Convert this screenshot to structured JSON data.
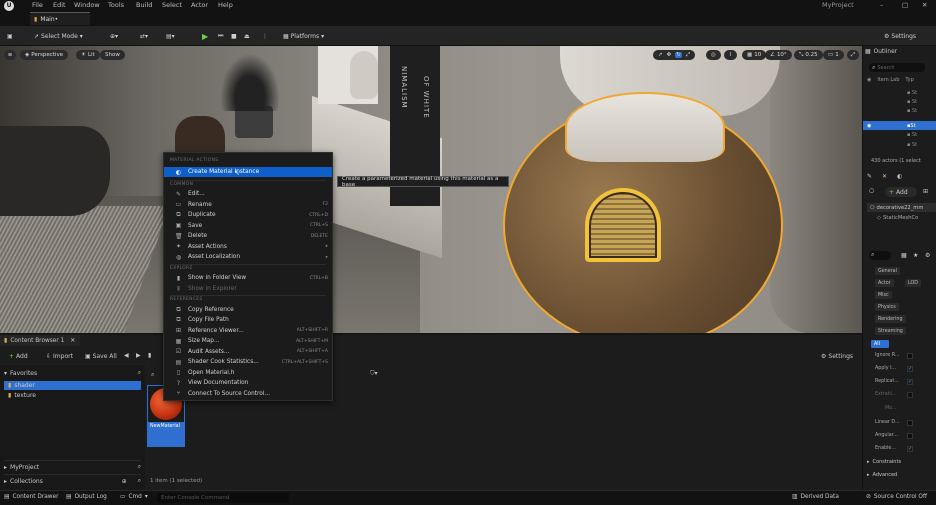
{
  "menubar": {
    "items": [
      "File",
      "Edit",
      "Window",
      "Tools",
      "Build",
      "Select",
      "Actor",
      "Help"
    ],
    "project": "MyProject"
  },
  "tab": {
    "label": "Main•"
  },
  "toolbar": {
    "select_mode": "Select Mode",
    "platforms": "Platforms",
    "settings": "Settings"
  },
  "viewport": {
    "perspective": "Perspective",
    "lit": "Lit",
    "show": "Show",
    "grid_snap": "10",
    "rot_snap": "10°",
    "scale_snap": "0.25",
    "cam_speed": "1"
  },
  "backdrop": {
    "book_text": "NIMALISM",
    "book_text2": "OF WHITE"
  },
  "context_menu": {
    "sections": [
      "MATERIAL ACTIONS",
      "COMMON",
      "EXPLORE",
      "REFERENCES"
    ],
    "items": [
      {
        "label": "Create Material Instance",
        "shortcut": "",
        "icon": "material-instance-icon"
      },
      {
        "label": "Edit...",
        "shortcut": "",
        "icon": "edit-icon"
      },
      {
        "label": "Rename",
        "shortcut": "F2",
        "icon": "rename-icon"
      },
      {
        "label": "Duplicate",
        "shortcut": "CTRL+D",
        "icon": "duplicate-icon"
      },
      {
        "label": "Save",
        "shortcut": "CTRL+S",
        "icon": "save-icon"
      },
      {
        "label": "Delete",
        "shortcut": "DELETE",
        "icon": "delete-icon"
      },
      {
        "label": "Asset Actions",
        "shortcut": "",
        "icon": "asset-actions-icon"
      },
      {
        "label": "Asset Localization",
        "shortcut": "",
        "icon": "localization-icon"
      },
      {
        "label": "Show in Folder View",
        "shortcut": "CTRL+B",
        "icon": "folder-view-icon"
      },
      {
        "label": "Show in Explorer",
        "shortcut": "",
        "icon": "explorer-icon"
      },
      {
        "label": "Copy Reference",
        "shortcut": "",
        "icon": "copy-reference-icon"
      },
      {
        "label": "Copy File Path",
        "shortcut": "",
        "icon": "copy-path-icon"
      },
      {
        "label": "Reference Viewer...",
        "shortcut": "ALT+SHIFT+R",
        "icon": "reference-viewer-icon"
      },
      {
        "label": "Size Map...",
        "shortcut": "ALT+SHIFT+M",
        "icon": "size-map-icon"
      },
      {
        "label": "Audit Assets...",
        "shortcut": "ALT+SHIFT+A",
        "icon": "audit-icon"
      },
      {
        "label": "Shader Cook Statistics...",
        "shortcut": "CTRL+ALT+SHIFT+S",
        "icon": "statistics-icon"
      },
      {
        "label": "Open Material.h",
        "shortcut": "",
        "icon": "code-file-icon"
      },
      {
        "label": "View Documentation",
        "shortcut": "",
        "icon": "documentation-icon"
      },
      {
        "label": "Connect To Source Control...",
        "shortcut": "",
        "icon": "source-control-icon"
      }
    ]
  },
  "tooltip": {
    "text": "Create a parameterized material using this material as a base"
  },
  "content_browser": {
    "tab": "Content Browser 1",
    "add": "Add",
    "import": "Import",
    "save_all": "Save All",
    "settings": "Settings",
    "favorites": "Favorites",
    "folders": [
      "shader",
      "texture"
    ],
    "my_project": "MyProject",
    "collections": "Collections",
    "asset_name": "NewMaterial",
    "status": "1 item (1 selected)"
  },
  "status_bar": {
    "content_drawer": "Content Drawer",
    "output_log": "Output Log",
    "cmd": "Cmd",
    "console_placeholder": "Enter Console Command",
    "derived_data": "Derived Data",
    "source_control": "Source Control Off"
  },
  "outliner": {
    "title": "Outliner",
    "search": "Search",
    "col_label": "Item Lab",
    "col_type": "Typ",
    "rows": [
      "St",
      "St",
      "St",
      "St",
      "St",
      "St"
    ],
    "count": "430 actors (1 select"
  },
  "details": {
    "add": "Add",
    "selected": "decorative22_mm",
    "component": "StaticMeshCo",
    "tabs": [
      "General",
      "Actor",
      "LOD",
      "Misc",
      "Physics",
      "Rendering",
      "Streaming",
      "All"
    ],
    "props": [
      "Ignore R...",
      "Apply I...",
      "Replicat...",
      "Extrahi...",
      "Mo...",
      "Linear D...",
      "Angular...",
      "Enable..."
    ],
    "sections": [
      "Constraints",
      "Advanced"
    ]
  },
  "colors": {
    "accent": "#0e5fc9",
    "selection": "#2f6fcf"
  }
}
